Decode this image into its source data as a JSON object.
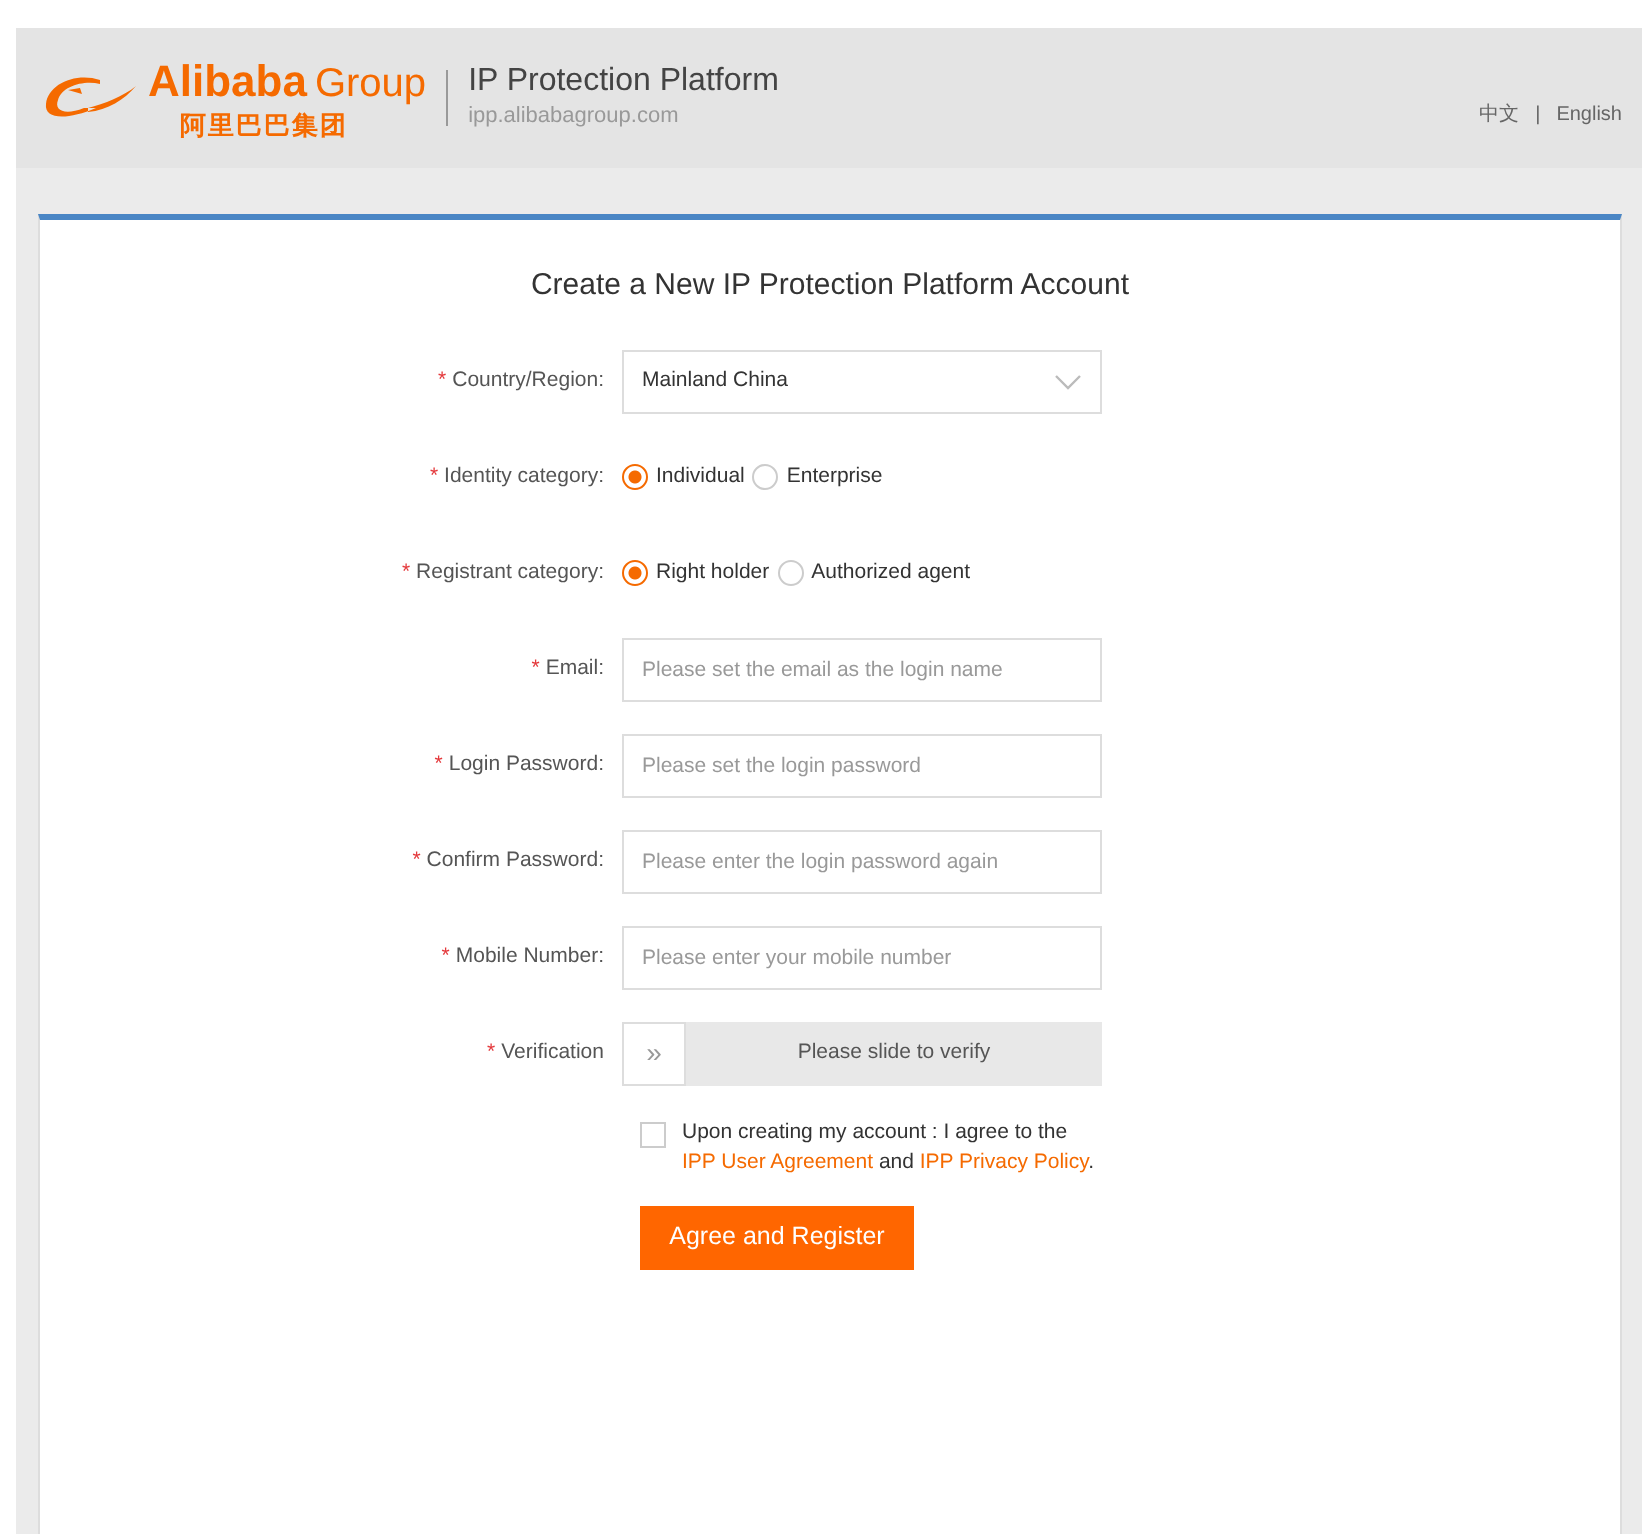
{
  "header": {
    "logo_text": "Alibaba",
    "logo_group": "Group",
    "logo_cn": "阿里巴巴集团",
    "title": "IP Protection Platform",
    "url": "ipp.alibabagroup.com",
    "languages": [
      "中文",
      "English"
    ],
    "language_separator": "|"
  },
  "form": {
    "title": "Create a New IP Protection Platform Account",
    "fields": [
      {
        "kind": "select",
        "required_mark": "*",
        "label": "Country/Region:",
        "value": "Mainland China"
      },
      {
        "kind": "radio",
        "required_mark": "*",
        "label": "Identity category:",
        "options": [
          {
            "label": "Individual",
            "selected": true
          },
          {
            "label": "Enterprise",
            "selected": false
          }
        ]
      },
      {
        "kind": "radio",
        "required_mark": "*",
        "label": "Registrant category:",
        "options": [
          {
            "label": "Right holder",
            "selected": true
          },
          {
            "label": "Authorized agent",
            "selected": false
          }
        ]
      },
      {
        "kind": "text",
        "required_mark": "*",
        "label": "Email:",
        "placeholder": "Please set the email as the login name"
      },
      {
        "kind": "text",
        "required_mark": "*",
        "label": "Login Password:",
        "placeholder": "Please set the login password"
      },
      {
        "kind": "text",
        "required_mark": "*",
        "label": "Confirm Password:",
        "placeholder": "Please enter the login password again"
      },
      {
        "kind": "text",
        "required_mark": "*",
        "label": "Mobile Number:",
        "placeholder": "Please enter your mobile number"
      },
      {
        "kind": "slider",
        "required_mark": "*",
        "label": "Verification",
        "handle": "»",
        "text": "Please slide to verify"
      }
    ],
    "agreement": {
      "checked": false,
      "parts": [
        {
          "kind": "text",
          "text": "Upon creating my account : I agree to the "
        },
        {
          "kind": "link",
          "text": "IPP User Agreement"
        },
        {
          "kind": "text",
          "text": " and "
        },
        {
          "kind": "link",
          "text": "IPP Privacy Policy"
        },
        {
          "kind": "text",
          "text": "."
        }
      ]
    },
    "submit": "Agree and Register"
  }
}
